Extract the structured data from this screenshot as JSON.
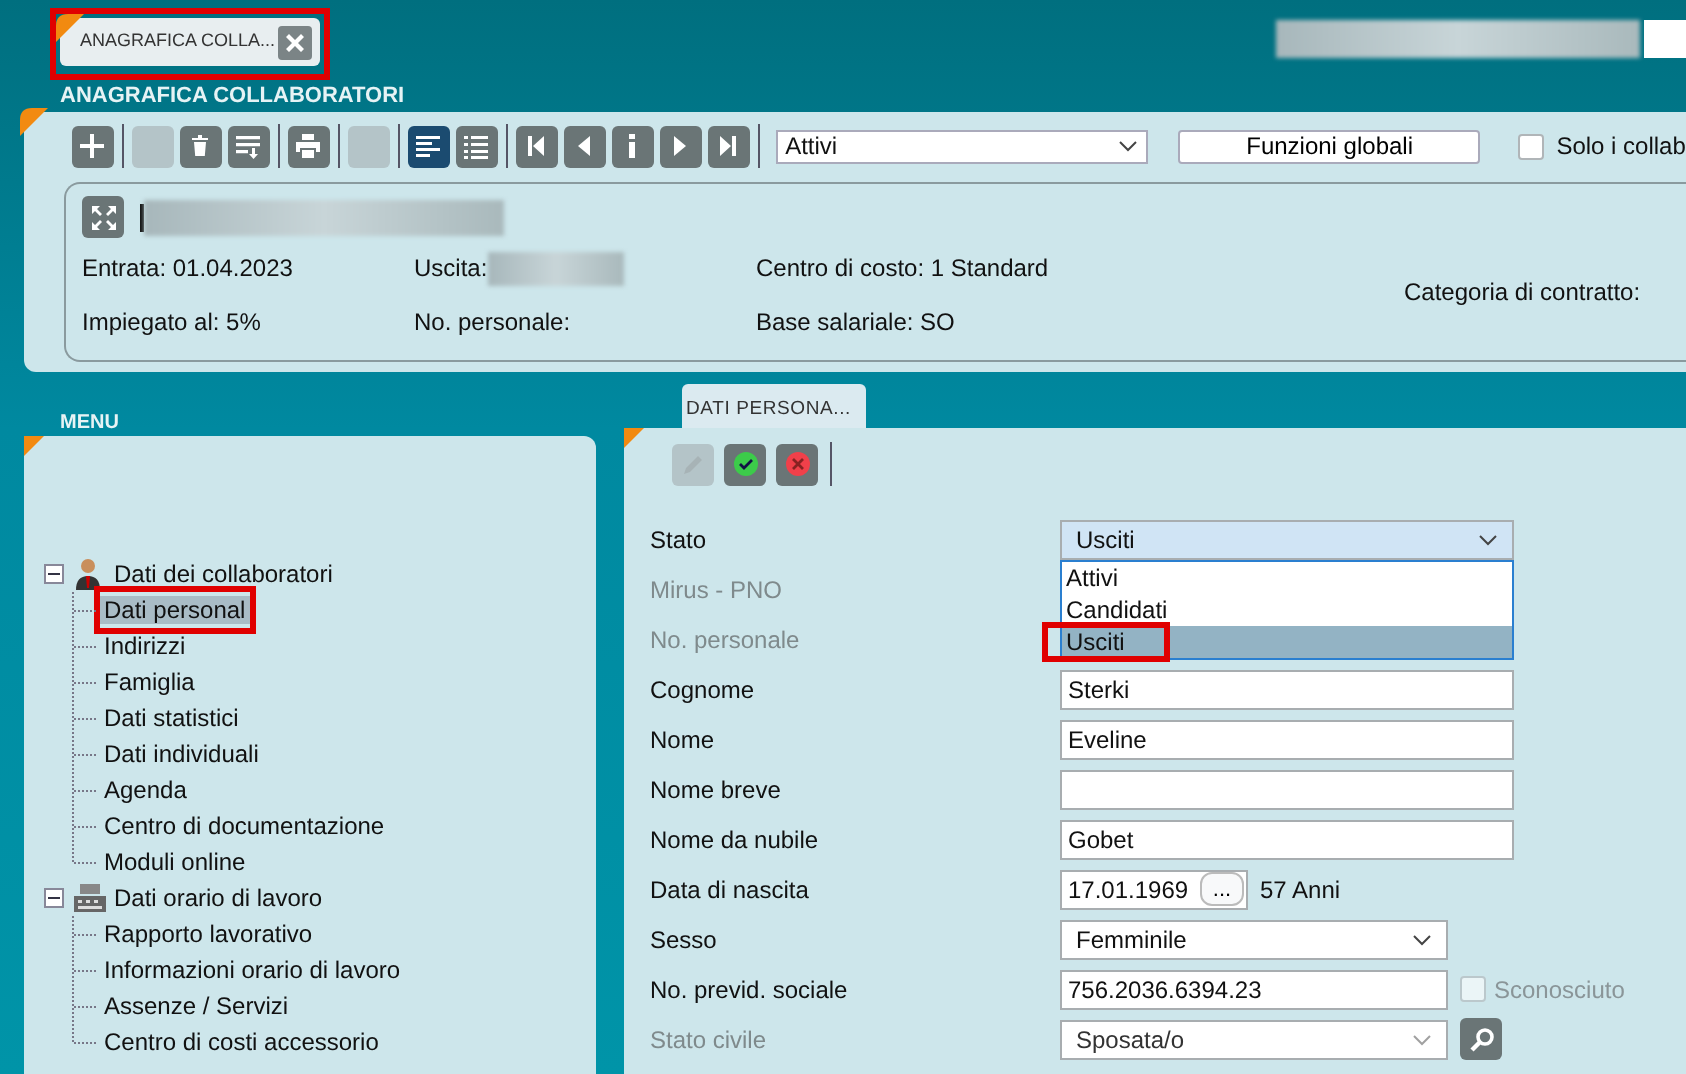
{
  "app_tab": {
    "label": "ANAGRAFICA COLLA...",
    "highlighted": true
  },
  "section_title": "ANAGRAFICA COLLABORATORI",
  "toolbar": {
    "buttons": [
      {
        "kind": "add",
        "disabled": false,
        "selected": false
      },
      {
        "kind": "blank",
        "disabled": true,
        "selected": false
      },
      {
        "kind": "delete",
        "disabled": false,
        "selected": false
      },
      {
        "kind": "export",
        "disabled": false,
        "selected": false
      },
      {
        "kind": "print",
        "disabled": false,
        "selected": false
      },
      {
        "kind": "blank",
        "disabled": true,
        "selected": false
      },
      {
        "kind": "detail-view",
        "disabled": false,
        "selected": true
      },
      {
        "kind": "list-view",
        "disabled": false,
        "selected": false
      },
      {
        "kind": "first",
        "disabled": false,
        "selected": false
      },
      {
        "kind": "prev",
        "disabled": false,
        "selected": false
      },
      {
        "kind": "info",
        "disabled": false,
        "selected": false
      },
      {
        "kind": "next",
        "disabled": false,
        "selected": false
      },
      {
        "kind": "last",
        "disabled": false,
        "selected": false
      }
    ],
    "filter": {
      "value": "Attivi"
    },
    "global_button": "Funzioni globali",
    "only_checkbox": {
      "label": "Solo i collab",
      "checked": false
    }
  },
  "summary": {
    "columns": [
      [
        "Entrata: 01.04.2023",
        "Impiegato al: 5%"
      ],
      [
        "Uscita:",
        "No. personale:"
      ],
      [
        "Centro di costo: 1 Standard",
        "Base salariale: SO"
      ],
      [
        "Categoria di contratto:"
      ]
    ]
  },
  "menu": {
    "title": "MENU",
    "items": [
      {
        "label": "Dati dei collaboratori",
        "kind": "person",
        "expanded": true,
        "children": [
          {
            "label": "Dati personal",
            "selected": true,
            "highlighted": true
          },
          {
            "label": "Indirizzi",
            "selected": false,
            "highlighted": false
          },
          {
            "label": "Famiglia",
            "selected": false,
            "highlighted": false
          },
          {
            "label": "Dati statistici",
            "selected": false,
            "highlighted": false
          },
          {
            "label": "Dati individuali",
            "selected": false,
            "highlighted": false
          },
          {
            "label": "Agenda",
            "selected": false,
            "highlighted": false
          },
          {
            "label": "Centro di documentazione",
            "selected": false,
            "highlighted": false
          },
          {
            "label": "Moduli online",
            "selected": false,
            "highlighted": false
          }
        ]
      },
      {
        "label": "Dati orario di lavoro",
        "kind": "register",
        "expanded": true,
        "children": [
          {
            "label": "Rapporto lavorativo",
            "selected": false,
            "highlighted": false
          },
          {
            "label": "Informazioni orario di lavoro",
            "selected": false,
            "highlighted": false
          },
          {
            "label": "Assenze / Servizi",
            "selected": false,
            "highlighted": false
          },
          {
            "label": "Centro di costi accessorio",
            "selected": false,
            "highlighted": false
          }
        ]
      }
    ]
  },
  "detail": {
    "tab": "DATI PERSONA...",
    "buttons": [
      {
        "kind": "edit",
        "disabled": true
      },
      {
        "kind": "confirm",
        "disabled": false
      },
      {
        "kind": "cancel",
        "disabled": false
      }
    ],
    "rows": [
      {
        "label": "Stato",
        "kind": "select",
        "value": "Usciti",
        "disabled": false,
        "open": true,
        "options": [
          {
            "label": "Attivi",
            "selected": false,
            "highlighted": false
          },
          {
            "label": "Candidati",
            "selected": false,
            "highlighted": false
          },
          {
            "label": "Usciti",
            "selected": true,
            "highlighted": true
          }
        ]
      },
      {
        "label": "Mirus - PNO",
        "kind": "hidden",
        "disabled": true
      },
      {
        "label": "No. personale",
        "kind": "hidden",
        "disabled": true
      },
      {
        "label": "Cognome",
        "kind": "text",
        "value": "Sterki",
        "disabled": false
      },
      {
        "label": "Nome",
        "kind": "text",
        "value": "Eveline",
        "disabled": false
      },
      {
        "label": "Nome breve",
        "kind": "text",
        "disabled": false
      },
      {
        "label": "Nome da nubile",
        "kind": "text",
        "value": "Gobet",
        "disabled": false
      },
      {
        "label": "Data di nascita",
        "kind": "date",
        "value": "17.01.1969",
        "button": "...",
        "note": "57 Anni",
        "disabled": false
      },
      {
        "label": "Sesso",
        "kind": "select",
        "value": "Femminile",
        "disabled": false,
        "open": false
      },
      {
        "label": "No. previd. sociale",
        "kind": "text",
        "value": "756.2036.6394.23",
        "disabled": false,
        "checkbox": {
          "label": "Sconosciuto",
          "checked": false,
          "disabled": true
        }
      },
      {
        "label": "Stato civile",
        "kind": "select",
        "value": "Sposata/o",
        "disabled": true,
        "open": false,
        "search": true
      }
    ]
  }
}
